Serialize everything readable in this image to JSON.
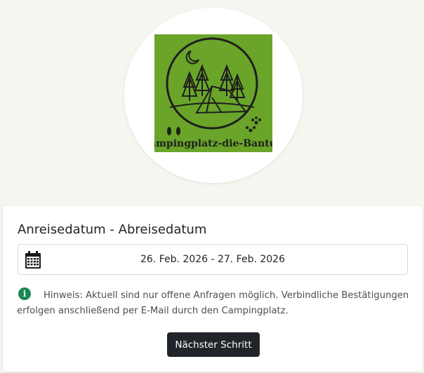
{
  "header": {
    "logo_text": "Campingplatz-die-Bantu's"
  },
  "booking": {
    "date_label": "Anreisedatum - Abreisedatum",
    "date_range": "26. Feb. 2026 - 27. Feb. 2026",
    "notice": "Hinweis: Aktuell sind nur offene Anfragen möglich. Verbindliche Bestätigungen erfolgen anschließend per E-Mail durch den Campingplatz.",
    "next_button": "Nächster Schritt"
  },
  "icons": {
    "calendar": "calendar-icon",
    "info": "info-icon"
  },
  "colors": {
    "logo_green": "#6aa52a",
    "button_bg": "#212529",
    "info_green": "#198754",
    "page_bg": "#f4f6ef"
  }
}
